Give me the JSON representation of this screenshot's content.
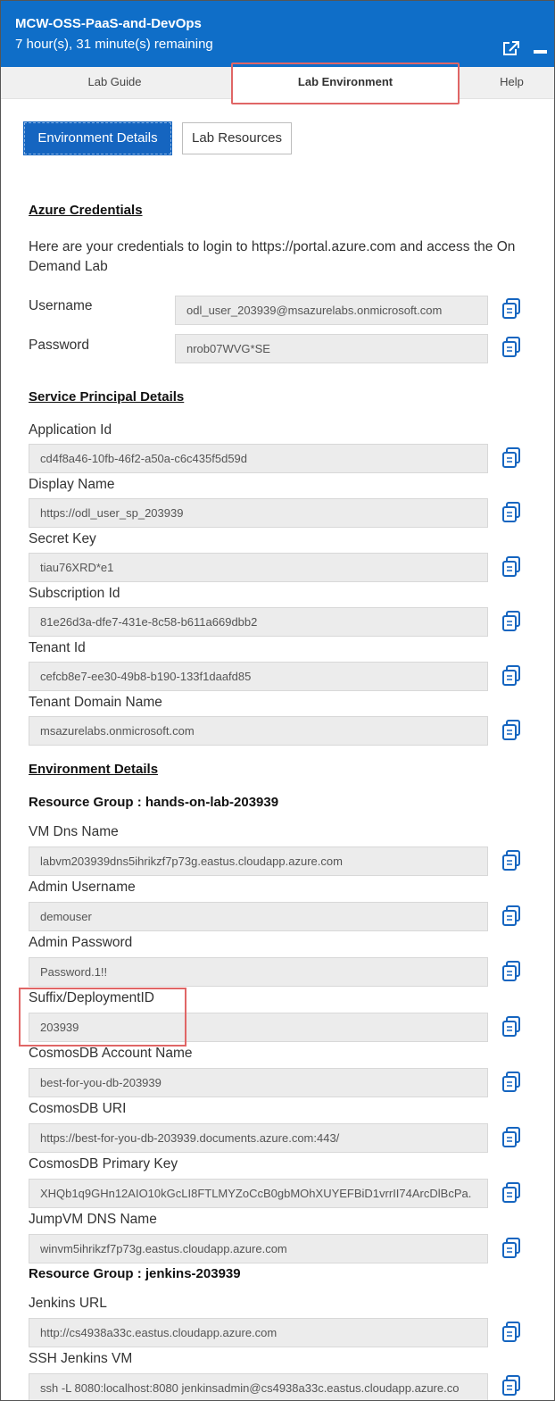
{
  "header": {
    "title": "MCW-OSS-PaaS-and-DevOps",
    "timer": "7 hour(s), 31 minute(s) remaining",
    "popout_icon": "external-link-icon",
    "minimize_icon": "minimize-icon"
  },
  "tabs": [
    {
      "label": "Lab Guide",
      "active": false
    },
    {
      "label": "Lab Environment",
      "active": true
    },
    {
      "label": "Help",
      "active": false
    }
  ],
  "buttons": {
    "environment_details": "Environment Details",
    "lab_resources": "Lab Resources"
  },
  "azure": {
    "title": "Azure Credentials",
    "intro": "Here are your credentials to login to https://portal.azure.com and access the On Demand Lab",
    "username_label": "Username",
    "username": "odl_user_203939@msazurelabs.onmicrosoft.com",
    "password_label": "Password",
    "password": "nrob07WVG*SE"
  },
  "sp": {
    "title": "Service Principal Details",
    "fields": [
      {
        "label": "Application Id",
        "value": "cd4f8a46-10fb-46f2-a50a-c6c435f5d59d"
      },
      {
        "label": "Display Name",
        "value": "https://odl_user_sp_203939"
      },
      {
        "label": "Secret Key",
        "value": "tiau76XRD*e1"
      },
      {
        "label": "Subscription Id",
        "value": "81e26d3a-dfe7-431e-8c58-b611a669dbb2"
      },
      {
        "label": "Tenant Id",
        "value": "cefcb8e7-ee30-49b8-b190-133f1daafd85"
      },
      {
        "label": "Tenant Domain Name",
        "value": "msazurelabs.onmicrosoft.com"
      }
    ]
  },
  "env": {
    "title": "Environment Details",
    "rg1": "Resource Group : hands-on-lab-203939",
    "fields1": [
      {
        "label": "VM Dns Name",
        "value": "labvm203939dns5ihrikzf7p73g.eastus.cloudapp.azure.com"
      },
      {
        "label": "Admin Username",
        "value": "demouser"
      },
      {
        "label": "Admin Password",
        "value": "Password.1!!"
      },
      {
        "label": "Suffix/DeploymentID",
        "value": "203939"
      },
      {
        "label": "CosmosDB Account Name",
        "value": "best-for-you-db-203939"
      },
      {
        "label": "CosmosDB URI",
        "value": "https://best-for-you-db-203939.documents.azure.com:443/"
      },
      {
        "label": "CosmosDB Primary Key",
        "value": "XHQb1q9GHn12AIO10kGcLI8FTLMYZoCcB0gbMOhXUYEFBiD1vrrII74ArcDlBcPa."
      },
      {
        "label": "JumpVM DNS Name",
        "value": "winvm5ihrikzf7p73g.eastus.cloudapp.azure.com"
      }
    ],
    "rg2": "Resource Group : jenkins-203939",
    "fields2": [
      {
        "label": "Jenkins URL",
        "value": "http://cs4938a33c.eastus.cloudapp.azure.com"
      },
      {
        "label": "SSH Jenkins VM",
        "value": "ssh -L 8080:localhost:8080 jenkinsadmin@cs4938a33c.eastus.cloudapp.azure.co"
      }
    ]
  },
  "icons": {
    "copy": "copy-icon"
  },
  "colors": {
    "header": "#0f6ec8",
    "primary_button": "#1565c0",
    "highlight": "#e06666",
    "copy_icon": "#1565c0"
  }
}
